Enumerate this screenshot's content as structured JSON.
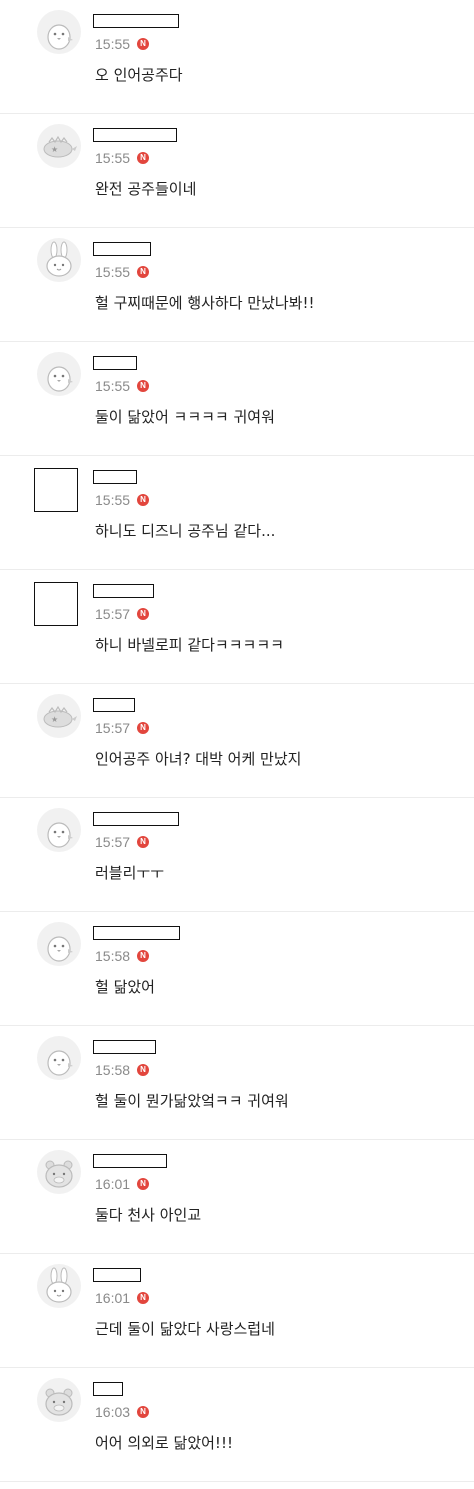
{
  "badge_letter": "N",
  "comments": [
    {
      "avatar": "penguin",
      "time": "15:55",
      "text": "오 인어공주다"
    },
    {
      "avatar": "dino",
      "time": "15:55",
      "text": "완전 공주들이네"
    },
    {
      "avatar": "rabbit",
      "time": "15:55",
      "text": "헐 구찌때문에 행사하다 만났나봐!!"
    },
    {
      "avatar": "penguin",
      "time": "15:55",
      "text": "둘이 닮았어 ㅋㅋㅋㅋ 귀여워"
    },
    {
      "avatar": "box",
      "time": "15:55",
      "text": "하니도 디즈니 공주님 같다..."
    },
    {
      "avatar": "box",
      "time": "15:57",
      "text": "하니 바넬로피 같다ㅋㅋㅋㅋㅋ"
    },
    {
      "avatar": "dino",
      "time": "15:57",
      "text": "인어공주 아녀? 대박 어케 만났지"
    },
    {
      "avatar": "penguin",
      "time": "15:57",
      "text": "러블리ㅜㅜ"
    },
    {
      "avatar": "penguin",
      "time": "15:58",
      "text": "헐 닮았어"
    },
    {
      "avatar": "penguin",
      "time": "15:58",
      "text": "헐 둘이 뭔가닮았엌ㅋㅋ 귀여워"
    },
    {
      "avatar": "bear",
      "time": "16:01",
      "text": "둘다 천사 아인교"
    },
    {
      "avatar": "rabbit",
      "time": "16:01",
      "text": "근데 둘이 닮았다 사랑스럽네"
    },
    {
      "avatar": "bear",
      "time": "16:03",
      "text": "어어 의외로 닮았어!!!"
    }
  ]
}
